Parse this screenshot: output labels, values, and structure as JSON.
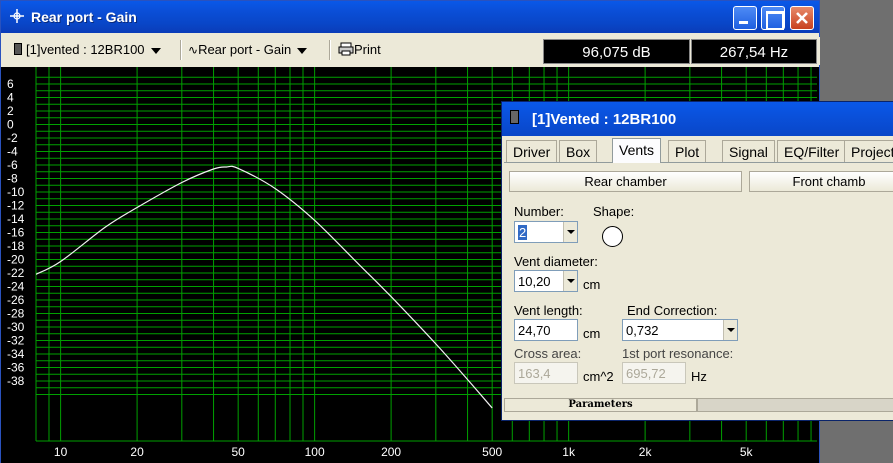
{
  "main_window": {
    "title": "Rear port - Gain",
    "project_selector": "[1]vented : 12BR100",
    "graph_selector": "Rear port - Gain",
    "print_label": "Print",
    "readout_db": "96,075 dB",
    "readout_hz": "267,54 Hz"
  },
  "plot": {
    "y_ticks": [
      "6",
      "4",
      "2",
      "0",
      "-2",
      "-4",
      "-6",
      "-8",
      "-10",
      "-12",
      "-14",
      "-16",
      "-18",
      "-20",
      "-22",
      "-24",
      "-26",
      "-28",
      "-30",
      "-32",
      "-34",
      "-36",
      "-38"
    ],
    "x_ticks": [
      "10",
      "20",
      "50",
      "100",
      "200",
      "500",
      "1k",
      "2k",
      "5k"
    ],
    "background": "#000000",
    "grid_color": "#00a000",
    "curve_color": "#f0f0f0"
  },
  "chart_data": {
    "type": "line",
    "title": "Rear port - Gain",
    "xlabel": "",
    "ylabel": "",
    "x_scale": "log",
    "xlim": [
      8,
      9500
    ],
    "ylim": [
      -40,
      7
    ],
    "grid": true,
    "series": [
      {
        "x": [
          8,
          10,
          15,
          20,
          30,
          40,
          45,
          50,
          70,
          100,
          150,
          200,
          300,
          400,
          500
        ],
        "values": [
          -22.2,
          -20.3,
          -15.2,
          -12.3,
          -8.6,
          -6.6,
          -6.3,
          -6.5,
          -9.5,
          -14.2,
          -20.8,
          -25.5,
          -32.5,
          -37.8,
          -42
        ]
      }
    ]
  },
  "dialog": {
    "title": "[1]Vented : 12BR100",
    "tabs": [
      "Driver",
      "Box",
      "Vents",
      "Plot",
      "Signal",
      "EQ/Filter",
      "Project"
    ],
    "active_tab": "Vents",
    "rear_chamber_label": "Rear chamber",
    "front_chamber_label": "Front chamb",
    "number_label": "Number:",
    "number_value": "2",
    "shape_label": "Shape:",
    "vent_diameter_label": "Vent diameter:",
    "vent_diameter_value": "10,20",
    "vent_diameter_unit": "cm",
    "vent_length_label": "Vent length:",
    "vent_length_value": "24,70",
    "vent_length_unit": "cm",
    "end_correction_label": "End Correction:",
    "end_correction_value": "0,732",
    "cross_area_label": "Cross area:",
    "cross_area_value": "163,4",
    "cross_area_unit": "cm^2",
    "port_resonance_label": "1st port resonance:",
    "port_resonance_value": "695,72",
    "port_resonance_unit": "Hz",
    "status_parameters": "Parameters"
  }
}
